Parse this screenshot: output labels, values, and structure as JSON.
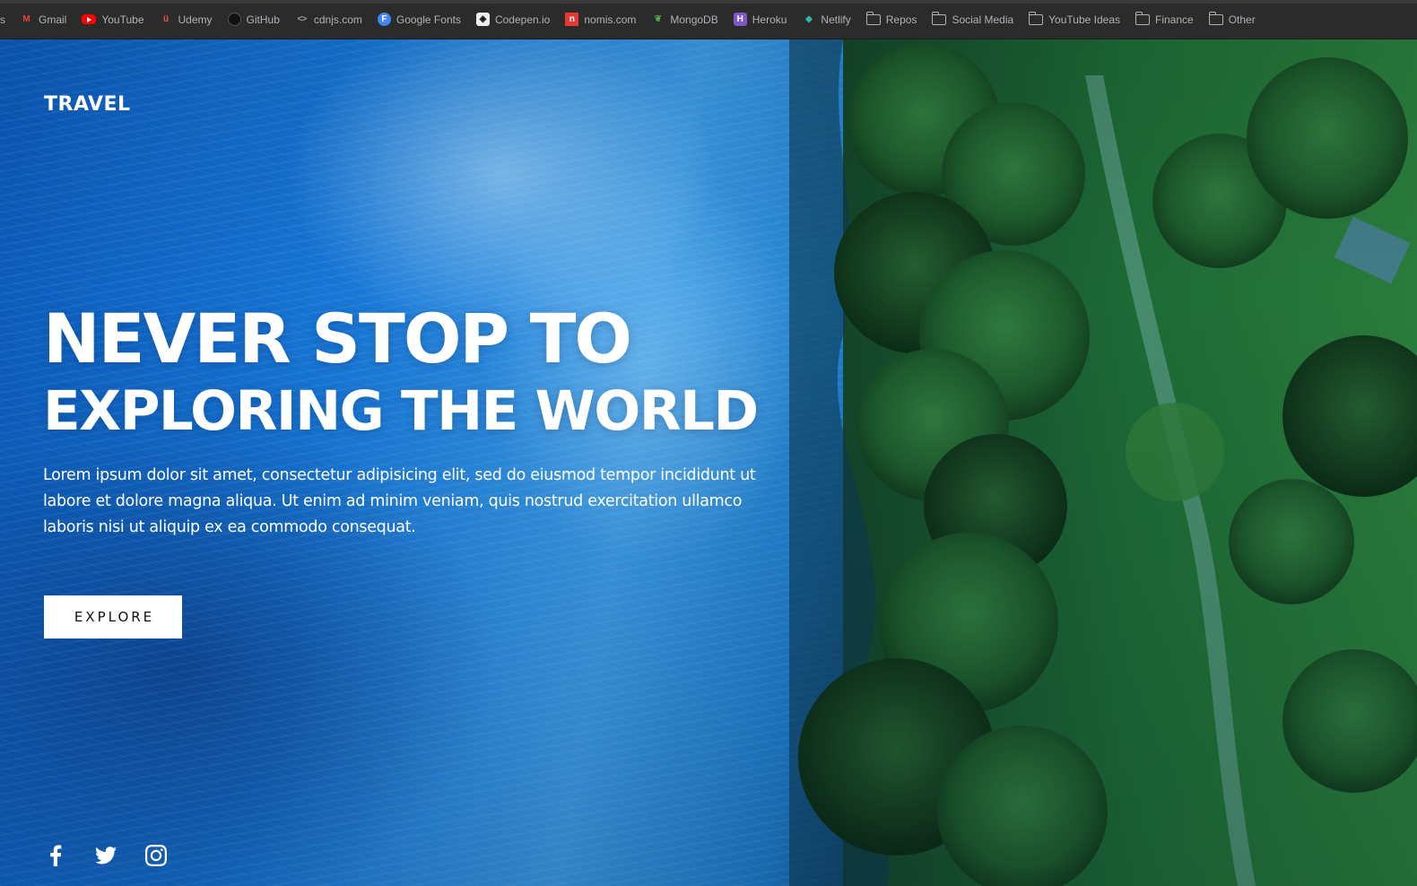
{
  "bookmarks": {
    "leading_fragment": "s",
    "items": [
      {
        "label": "Gmail",
        "icon": "gmail-icon"
      },
      {
        "label": "YouTube",
        "icon": "youtube-icon"
      },
      {
        "label": "Udemy",
        "icon": "udemy-icon"
      },
      {
        "label": "GitHub",
        "icon": "github-icon"
      },
      {
        "label": "cdnjs.com",
        "icon": "code-brackets-icon"
      },
      {
        "label": "Google Fonts",
        "icon": "google-fonts-icon"
      },
      {
        "label": "Codepen.io",
        "icon": "codepen-icon"
      },
      {
        "label": "nomis.com",
        "icon": "nomis-icon"
      },
      {
        "label": "MongoDB",
        "icon": "mongodb-leaf-icon"
      },
      {
        "label": "Heroku",
        "icon": "heroku-icon"
      },
      {
        "label": "Netlify",
        "icon": "netlify-icon"
      },
      {
        "label": "Repos",
        "icon": "folder-icon"
      },
      {
        "label": "Social Media",
        "icon": "folder-icon"
      },
      {
        "label": "YouTube Ideas",
        "icon": "folder-icon"
      },
      {
        "label": "Finance",
        "icon": "folder-icon"
      },
      {
        "label": "Other",
        "icon": "folder-icon"
      }
    ]
  },
  "hero": {
    "logo": "TRAVEL",
    "headline_line1": "NEVER STOP TO",
    "headline_line2": "EXPLORING THE WORLD",
    "paragraph": "Lorem ipsum dolor sit amet, consectetur adipisicing elit, sed do eiusmod tempor incididunt ut labore et dolore magna aliqua. Ut enim ad minim veniam, quis nostrud exercitation ullamco laboris nisi ut aliquip ex ea commodo consequat.",
    "cta_label": "EXPLORE",
    "background": "aerial-ocean-and-forest-video",
    "colors": {
      "ocean": "#1676d6",
      "forest": "#0f4a2a",
      "text": "#ffffff",
      "button_bg": "#ffffff",
      "button_text": "#111111"
    }
  },
  "social": [
    {
      "name": "facebook-icon"
    },
    {
      "name": "twitter-icon"
    },
    {
      "name": "instagram-icon"
    }
  ]
}
